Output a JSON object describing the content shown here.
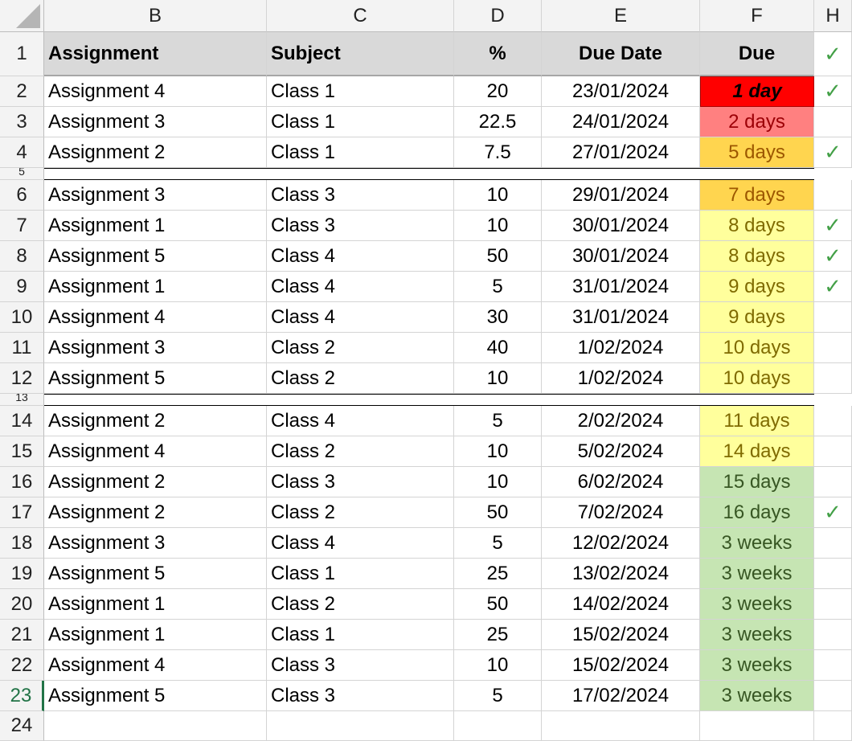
{
  "columns": [
    "B",
    "C",
    "D",
    "E",
    "F",
    "H"
  ],
  "row_numbers": [
    "1",
    "2",
    "3",
    "4",
    "5",
    "6",
    "7",
    "8",
    "9",
    "10",
    "11",
    "12",
    "13",
    "14",
    "15",
    "16",
    "17",
    "18",
    "19",
    "20",
    "21",
    "22",
    "23",
    "24"
  ],
  "active_row": "23",
  "header": {
    "assignment": "Assignment",
    "subject": "Subject",
    "percent": "%",
    "due_date": "Due Date",
    "due": "Due",
    "done": "✓"
  },
  "rows": [
    {
      "assignment": "Assignment 4",
      "subject": "Class 1",
      "percent": "20",
      "due_date": "23/01/2024",
      "due": "1 day",
      "done": "✓",
      "level": "critical"
    },
    {
      "assignment": "Assignment 3",
      "subject": "Class 1",
      "percent": "22.5",
      "due_date": "24/01/2024",
      "due": "2 days",
      "done": "",
      "level": "urgent"
    },
    {
      "assignment": "Assignment 2",
      "subject": "Class 1",
      "percent": "7.5",
      "due_date": "27/01/2024",
      "due": "5 days",
      "done": "✓",
      "level": "soon"
    },
    {
      "assignment": "Assignment 3",
      "subject": "Class 3",
      "percent": "10",
      "due_date": "29/01/2024",
      "due": "7 days",
      "done": "",
      "level": "soon"
    },
    {
      "assignment": "Assignment 1",
      "subject": "Class 3",
      "percent": "10",
      "due_date": "30/01/2024",
      "due": "8 days",
      "done": "✓",
      "level": "week"
    },
    {
      "assignment": "Assignment 5",
      "subject": "Class 4",
      "percent": "50",
      "due_date": "30/01/2024",
      "due": "8 days",
      "done": "✓",
      "level": "week"
    },
    {
      "assignment": "Assignment 1",
      "subject": "Class 4",
      "percent": "5",
      "due_date": "31/01/2024",
      "due": "9 days",
      "done": "✓",
      "level": "week"
    },
    {
      "assignment": "Assignment 4",
      "subject": "Class 4",
      "percent": "30",
      "due_date": "31/01/2024",
      "due": "9 days",
      "done": "",
      "level": "week"
    },
    {
      "assignment": "Assignment 3",
      "subject": "Class 2",
      "percent": "40",
      "due_date": "1/02/2024",
      "due": "10 days",
      "done": "",
      "level": "week"
    },
    {
      "assignment": "Assignment 5",
      "subject": "Class 2",
      "percent": "10",
      "due_date": "1/02/2024",
      "due": "10 days",
      "done": "",
      "level": "week"
    },
    {
      "assignment": "Assignment 2",
      "subject": "Class 4",
      "percent": "5",
      "due_date": "2/02/2024",
      "due": "11 days",
      "done": "",
      "level": "week"
    },
    {
      "assignment": "Assignment 4",
      "subject": "Class 2",
      "percent": "10",
      "due_date": "5/02/2024",
      "due": "14 days",
      "done": "",
      "level": "week"
    },
    {
      "assignment": "Assignment 2",
      "subject": "Class 3",
      "percent": "10",
      "due_date": "6/02/2024",
      "due": "15 days",
      "done": "",
      "level": "later"
    },
    {
      "assignment": "Assignment 2",
      "subject": "Class 2",
      "percent": "50",
      "due_date": "7/02/2024",
      "due": "16 days",
      "done": "✓",
      "level": "later"
    },
    {
      "assignment": "Assignment 3",
      "subject": "Class 4",
      "percent": "5",
      "due_date": "12/02/2024",
      "due": "3 weeks",
      "done": "",
      "level": "later"
    },
    {
      "assignment": "Assignment 5",
      "subject": "Class 1",
      "percent": "25",
      "due_date": "13/02/2024",
      "due": "3 weeks",
      "done": "",
      "level": "later"
    },
    {
      "assignment": "Assignment 1",
      "subject": "Class 2",
      "percent": "50",
      "due_date": "14/02/2024",
      "due": "3 weeks",
      "done": "",
      "level": "later"
    },
    {
      "assignment": "Assignment 1",
      "subject": "Class 1",
      "percent": "25",
      "due_date": "15/02/2024",
      "due": "3 weeks",
      "done": "",
      "level": "later"
    },
    {
      "assignment": "Assignment 4",
      "subject": "Class 3",
      "percent": "10",
      "due_date": "15/02/2024",
      "due": "3 weeks",
      "done": "",
      "level": "later"
    },
    {
      "assignment": "Assignment 5",
      "subject": "Class 3",
      "percent": "5",
      "due_date": "17/02/2024",
      "due": "3 weeks",
      "done": "",
      "level": "later"
    }
  ],
  "due_styles": {
    "critical": {
      "bg": "#ff0000",
      "fg": "#000000",
      "bold": true,
      "italic": true
    },
    "urgent": {
      "bg": "#ff8080",
      "fg": "#9c0006",
      "bold": false,
      "italic": false
    },
    "soon": {
      "bg": "#ffd54f",
      "fg": "#9c5700",
      "bold": false,
      "italic": false
    },
    "week": {
      "bg": "#ffff9c",
      "fg": "#7f6a00",
      "bold": false,
      "italic": false
    },
    "later": {
      "bg": "#c6e5b3",
      "fg": "#375623",
      "bold": false,
      "italic": false
    }
  },
  "check_color": "#43a047"
}
